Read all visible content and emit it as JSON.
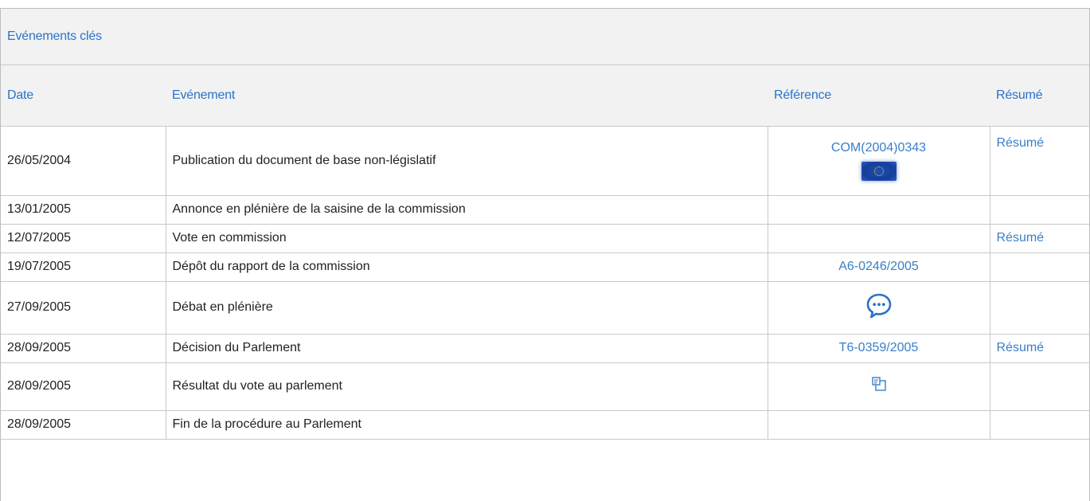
{
  "panel": {
    "title": "Evénements clés"
  },
  "columns": {
    "date": "Date",
    "event": "Evénement",
    "reference": "Référence",
    "summary": "Résumé"
  },
  "rows": [
    {
      "date": "26/05/2004",
      "event": "Publication du document de base non-législatif",
      "reference": "COM(2004)0343",
      "ref_icon": "eu-flag-icon",
      "summary": "Résumé"
    },
    {
      "date": "13/01/2005",
      "event": "Annonce en plénière de la saisine de la commission",
      "reference": "",
      "summary": ""
    },
    {
      "date": "12/07/2005",
      "event": "Vote en commission",
      "reference": "",
      "summary": "Résumé"
    },
    {
      "date": "19/07/2005",
      "event": "Dépôt du rapport de la commission",
      "reference": "A6-0246/2005",
      "summary": ""
    },
    {
      "date": "27/09/2005",
      "event": "Débat en plénière",
      "reference": "",
      "ref_icon": "speech-bubble-icon",
      "summary": ""
    },
    {
      "date": "28/09/2005",
      "event": "Décision du Parlement",
      "reference": "T6-0359/2005",
      "summary": "Résumé"
    },
    {
      "date": "28/09/2005",
      "event": "Résultat du vote au parlement",
      "reference": "",
      "ref_icon": "vote-result-icon",
      "summary": ""
    },
    {
      "date": "28/09/2005",
      "event": "Fin de la procédure au Parlement",
      "reference": "",
      "summary": ""
    }
  ],
  "colors": {
    "link": "#3a7fc6",
    "header_bg": "#f2f2f2",
    "border": "#c9c9c9"
  }
}
